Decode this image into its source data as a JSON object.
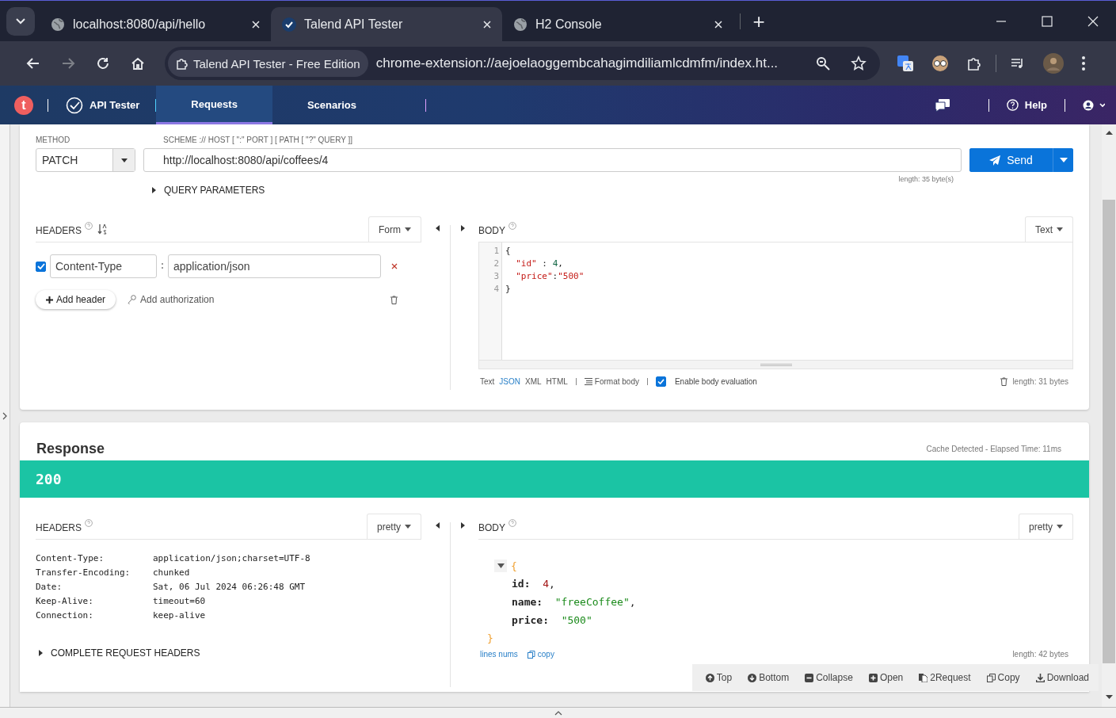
{
  "browser": {
    "tabs": [
      {
        "title": "localhost:8080/api/hello",
        "selected": false
      },
      {
        "title": "Talend API Tester",
        "selected": true
      },
      {
        "title": "H2 Console",
        "selected": false
      }
    ],
    "new_tab": "+",
    "address": {
      "site_chip": "Talend API Tester - Free Edition",
      "url": "chrome-extension://aejoelaoggembcahagimdiliamlcdmfm/index.ht..."
    }
  },
  "app_bar": {
    "logo": "t",
    "product": "API Tester",
    "tabs": [
      {
        "label": "Requests",
        "selected": true
      },
      {
        "label": "Scenarios",
        "selected": false
      }
    ],
    "help": "Help"
  },
  "request": {
    "method_label": "METHOD",
    "method": "PATCH",
    "url_label": "SCHEME :// HOST [ \":\" PORT ] [ PATH [ \"?\" QUERY ]]",
    "url": "http://localhost:8080/api/coffees/4",
    "send": "Send",
    "url_length": "length: 35 byte(s)",
    "query_parameters": "QUERY PARAMETERS",
    "headers": {
      "title": "HEADERS",
      "mode": "Form",
      "rows": [
        {
          "checked": true,
          "name": "Content-Type",
          "value": "application/json"
        }
      ],
      "add_header": "Add header",
      "add_authorization": "Add authorization"
    },
    "body": {
      "title": "BODY",
      "mode": "Text",
      "lines": [
        {
          "number": "1",
          "tokens": [
            {
              "kind": "punct",
              "text": "{"
            }
          ]
        },
        {
          "number": "2",
          "tokens": [
            {
              "kind": "key",
              "text": "  \"id\""
            },
            {
              "kind": "punct",
              "text": " : "
            },
            {
              "kind": "number",
              "text": "4"
            },
            {
              "kind": "punct",
              "text": ","
            }
          ]
        },
        {
          "number": "3",
          "tokens": [
            {
              "kind": "key",
              "text": "  \"price\""
            },
            {
              "kind": "punct",
              "text": ":"
            },
            {
              "kind": "string",
              "text": "\"500\""
            }
          ]
        },
        {
          "number": "4",
          "tokens": [
            {
              "kind": "punct",
              "text": "}"
            }
          ]
        }
      ],
      "formats": [
        {
          "label": "Text",
          "selected": false
        },
        {
          "label": "JSON",
          "selected": true
        },
        {
          "label": "XML",
          "selected": false
        },
        {
          "label": "HTML",
          "selected": false
        }
      ],
      "format_body": "Format body",
      "evaluation": {
        "label": "Enable body evaluation",
        "checked": true
      },
      "length": "length: 31 bytes"
    }
  },
  "response": {
    "title": "Response",
    "timing": "Cache Detected - Elapsed Time: 11ms",
    "status": "200",
    "headers": {
      "title": "HEADERS",
      "mode": "pretty",
      "rows": [
        {
          "name": "Content-Type:",
          "value": "application/json;charset=UTF-8"
        },
        {
          "name": "Transfer-Encoding:",
          "value": "chunked"
        },
        {
          "name": "Date:",
          "value": "Sat, 06 Jul 2024 06:26:48 GMT"
        },
        {
          "name": "Keep-Alive:",
          "value": "timeout=60"
        },
        {
          "name": "Connection:",
          "value": "keep-alive"
        }
      ],
      "complete": "COMPLETE REQUEST HEADERS"
    },
    "body": {
      "title": "BODY",
      "mode": "pretty",
      "expanded": true,
      "open": "{",
      "close": "}",
      "fields": [
        {
          "key": "id:",
          "value": "4",
          "kind": "number",
          "suffix": ","
        },
        {
          "key": "name:",
          "value": "\"freeCoffee\"",
          "kind": "string",
          "suffix": ","
        },
        {
          "key": "price:",
          "value": "\"500\"",
          "kind": "string"
        }
      ],
      "line_numbers": "lines nums",
      "copy": "copy",
      "length": "length: 42 bytes"
    }
  },
  "toolbar": [
    "Top",
    "Bottom",
    "Collapse",
    "Open",
    "2Request",
    "Copy",
    "Download"
  ]
}
